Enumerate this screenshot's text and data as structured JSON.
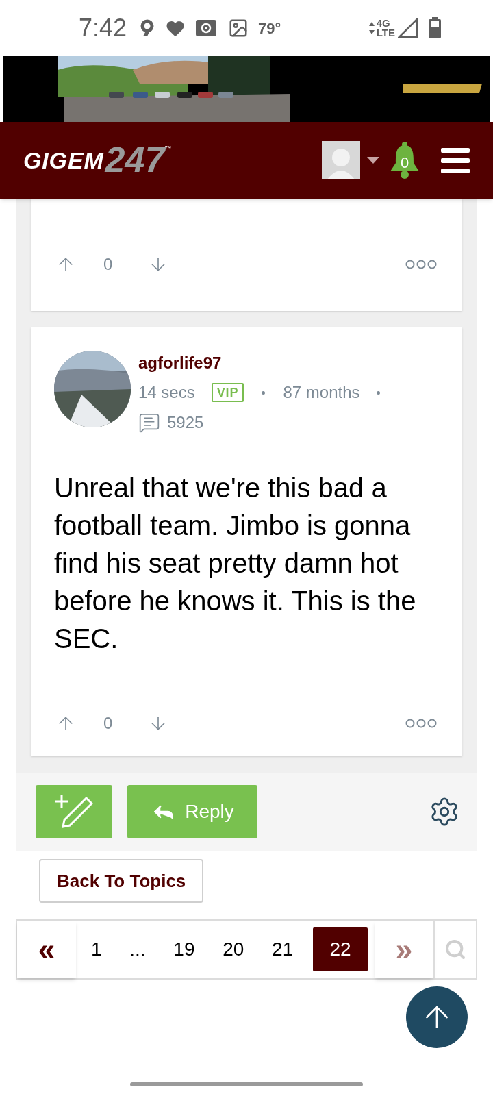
{
  "status_bar": {
    "time": "7:42",
    "temperature": "79°",
    "network_top": "4G",
    "network_bottom": "LTE"
  },
  "header": {
    "logo_word": "GIGEM",
    "logo_number": "247",
    "trademark": "™",
    "notifications": "0"
  },
  "posts": [
    {
      "kind": "partial",
      "score": "0"
    },
    {
      "kind": "full",
      "author": "agforlife97",
      "time": "14 secs",
      "badge": "VIP",
      "tenure": "87 months",
      "comments": "5925",
      "body": "Unreal that we're this bad a football team. Jimbo is gonna find his seat pretty damn hot before he knows it. This is the SEC.",
      "score": "0"
    }
  ],
  "actions": {
    "reply": "Reply"
  },
  "back_button": "Back To Topics",
  "pagination": {
    "first": "«",
    "next": "»",
    "pages": [
      {
        "label": "1",
        "selected": false
      },
      {
        "label": "...",
        "selected": false
      },
      {
        "label": "19",
        "selected": false
      },
      {
        "label": "20",
        "selected": false
      },
      {
        "label": "21",
        "selected": false
      },
      {
        "label": "22",
        "selected": true
      }
    ]
  }
}
